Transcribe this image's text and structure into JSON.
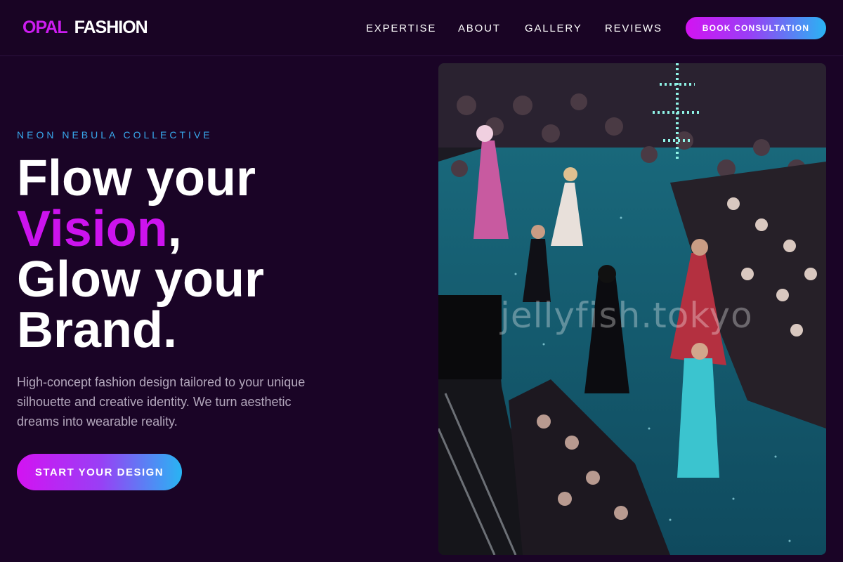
{
  "header": {
    "logo_accent": "OPAL",
    "logo_rest": "FASHION",
    "nav": [
      "EXPERTISE",
      "ABOUT",
      "GALLERY",
      "REVIEWS"
    ],
    "cta": "BOOK CONSULTATION"
  },
  "hero": {
    "eyebrow": "NEON NEBULA COLLECTIVE",
    "headline_line1": "Flow your",
    "headline_highlight": "Vision",
    "headline_comma": ",",
    "headline_line3": "Glow your",
    "headline_line4": "Brand.",
    "description": "High-concept fashion design tailored to your unique silhouette and creative identity. We turn aesthetic dreams into wearable reality.",
    "cta": "START YOUR DESIGN"
  },
  "image": {
    "watermark": "jellyfish.tokyo"
  },
  "colors": {
    "background": "#1a0426",
    "accent_magenta": "#cc13ee",
    "accent_cyan": "#29b4f3",
    "eyebrow": "#38a8ec"
  }
}
